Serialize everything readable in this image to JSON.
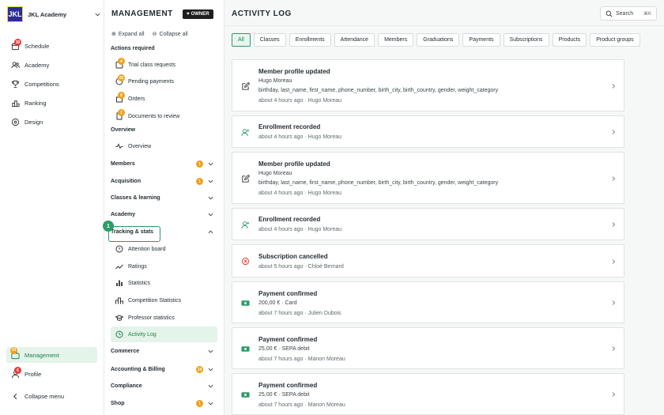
{
  "account": {
    "logo": "JKL",
    "name": "JKL Academy"
  },
  "nav": [
    {
      "label": "Schedule",
      "icon": "calendar-icon",
      "badge": "30"
    },
    {
      "label": "Academy",
      "icon": "users-icon"
    },
    {
      "label": "Competitions",
      "icon": "trophy-icon"
    },
    {
      "label": "Ranking",
      "icon": "ranking-icon"
    },
    {
      "label": "Design",
      "icon": "palette-icon"
    }
  ],
  "bottom_nav": {
    "management": "Management",
    "management_badge": "33",
    "profile": "Profile",
    "profile_badge": "6",
    "collapse": "Collapse menu"
  },
  "panel": {
    "title": "MANAGEMENT",
    "owner": "OWNER",
    "expand_all": "Expand all",
    "collapse_all": "Collapse all",
    "actions_required": "Actions required",
    "actions": [
      {
        "label": "Trial class requests",
        "badge": "4"
      },
      {
        "label": "Pending payments",
        "badge": "20"
      },
      {
        "label": "Orders",
        "badge": "8"
      },
      {
        "label": "Documents to review",
        "badge": "1"
      }
    ],
    "overview_section": "Overview",
    "overview_item": "Overview",
    "members": "Members",
    "members_badge": "1",
    "acquisition": "Acquisition",
    "acquisition_badge": "1",
    "classes": "Classes & learning",
    "academy": "Academy",
    "tracking": "Tracking & stats",
    "tracking_items": [
      "Attention board",
      "Ratings",
      "Statistics",
      "Competition Statistics",
      "Professor statistics",
      "Activity Log"
    ],
    "commerce": "Commerce",
    "accounting": "Accounting & Billing",
    "accounting_badge": "19",
    "compliance": "Compliance",
    "shop": "Shop",
    "shop_badge": "1",
    "highlight_number": "1"
  },
  "main": {
    "title": "ACTIVITY LOG",
    "search": "Search",
    "shortcut": "⌘K",
    "tabs": [
      "All",
      "Classes",
      "Enrollments",
      "Attendance",
      "Members",
      "Graduations",
      "Payments",
      "Subscriptions",
      "Products",
      "Product groups"
    ],
    "entries": [
      {
        "type": "edit",
        "title": "Member profile updated",
        "sub1": "Hugo Moreau",
        "sub2": "birthday, last_name, first_name, phone_number, birth_city, birth_country, gender, weight_category",
        "meta": "about 4 hours ago · Hugo Moreau"
      },
      {
        "type": "enroll",
        "title": "Enrollment recorded",
        "meta": "about 4 hours ago · Hugo Moreau"
      },
      {
        "type": "edit",
        "title": "Member profile updated",
        "sub1": "Hugo Moreau",
        "sub2": "birthday, last_name, first_name, phone_number, birth_city, birth_country, gender, weight_category",
        "meta": "about 4 hours ago · Hugo Moreau"
      },
      {
        "type": "enroll",
        "title": "Enrollment recorded",
        "meta": "about 4 hours ago · Hugo Moreau"
      },
      {
        "type": "cancel",
        "title": "Subscription cancelled",
        "meta": "about 5 hours ago · Chloé Bernard"
      },
      {
        "type": "pay",
        "title": "Payment confirmed",
        "sub1": "200,00 € · Card",
        "meta": "about 7 hours ago · Julien Dubois"
      },
      {
        "type": "pay",
        "title": "Payment confirmed",
        "sub1": "25,00 € · SEPA debit",
        "meta": "about 7 hours ago · Manon Moreau"
      },
      {
        "type": "pay",
        "title": "Payment confirmed",
        "sub1": "25,00 € · SEPA debit",
        "meta": "about 7 hours ago · Manon Moreau"
      }
    ]
  },
  "colors": {
    "accent": "#2d9b68",
    "badge_red": "#e53935",
    "badge_orange": "#f0a11a",
    "cancel": "#e53935"
  }
}
